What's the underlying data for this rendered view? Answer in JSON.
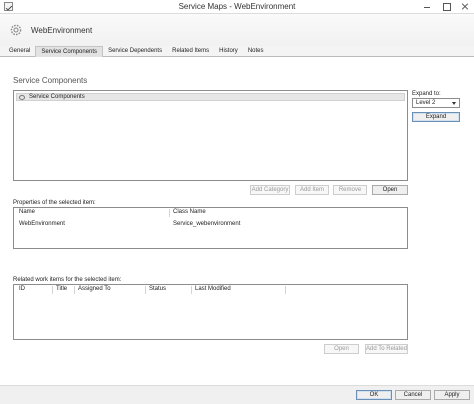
{
  "window": {
    "title": "Service Maps - WebEnvironment"
  },
  "header": {
    "title": "WebEnvironment"
  },
  "tabs": [
    {
      "label": "General"
    },
    {
      "label": "Service Components"
    },
    {
      "label": "Service Dependents"
    },
    {
      "label": "Related Items"
    },
    {
      "label": "History"
    },
    {
      "label": "Notes"
    }
  ],
  "service_components": {
    "heading": "Service Components",
    "tree": [
      {
        "label": "Service Components"
      }
    ],
    "expand_to_label": "Expand to:",
    "expand_level": "Level 2",
    "expand_button": "Expand",
    "buttons": {
      "add_category": "Add Category",
      "add_item": "Add Item",
      "remove": "Remove",
      "open": "Open"
    }
  },
  "properties": {
    "label": "Properties of the selected item:",
    "columns": [
      "Name",
      "Class Name"
    ],
    "rows": [
      [
        "WebEnvironment",
        "Service_webenvironment"
      ]
    ]
  },
  "related_work_items": {
    "label": "Related work items for the selected item:",
    "columns": [
      "ID",
      "Title",
      "Assigned To",
      "Status",
      "Last Modified"
    ],
    "buttons": {
      "open": "Open",
      "add_to_related": "Add To Related"
    }
  },
  "footer": {
    "ok": "OK",
    "cancel": "Cancel",
    "apply": "Apply"
  }
}
